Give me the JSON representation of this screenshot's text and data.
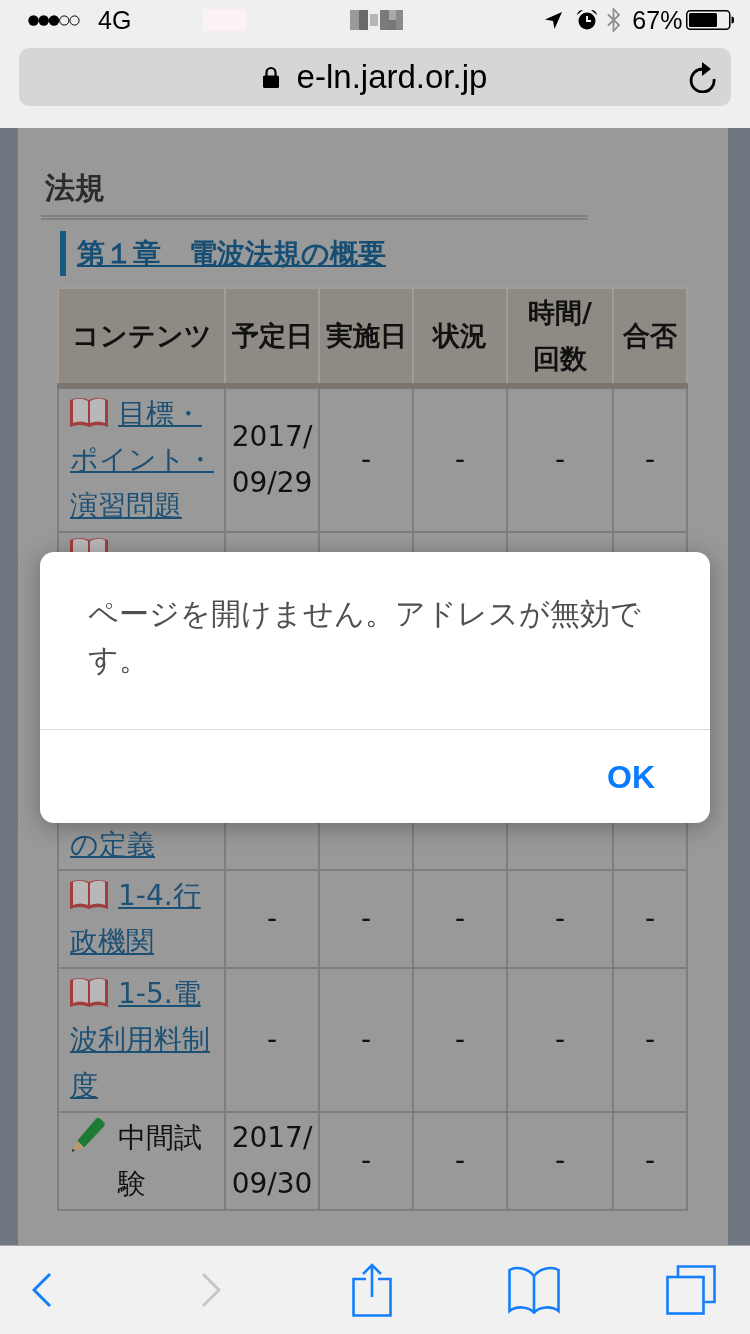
{
  "status_bar": {
    "network": "4G",
    "battery": "67%"
  },
  "address_bar": {
    "url": "e-ln.jard.or.jp"
  },
  "page": {
    "section_title": "法規",
    "chapter_link": "第１章　電波法規の概要",
    "table": {
      "columns": [
        "コンテンツ",
        "予定日",
        "実施日",
        "状況",
        "時間/回数",
        "合否"
      ],
      "rows_before_alert": [
        {
          "kind": "lesson",
          "content": "目標・ポイント・演習問題",
          "cells": [
            "2017/09/29",
            "-",
            "-",
            "-",
            "-"
          ]
        }
      ],
      "rows_under_alert": {
        "top": {
          "kind": "lesson"
        },
        "bottom": {
          "kind": "lesson",
          "content": "の定義"
        }
      },
      "rows_after_alert": [
        {
          "kind": "lesson",
          "content": "1-4.行政機関",
          "cells": [
            "-",
            "-",
            "-",
            "-",
            "-"
          ]
        },
        {
          "kind": "lesson",
          "content": "1-5.電波利用料制度",
          "cells": [
            "-",
            "-",
            "-",
            "-",
            "-"
          ]
        },
        {
          "kind": "test",
          "content": "中間試験",
          "cells": [
            "2017/09/30",
            "-",
            "-",
            "-",
            "-"
          ]
        }
      ]
    }
  },
  "alert": {
    "message": "ページを開けません。アドレスが無効です。",
    "button": "OK"
  },
  "toolbar": {
    "back": {
      "disabled": false
    },
    "forward": {
      "disabled": true
    }
  }
}
